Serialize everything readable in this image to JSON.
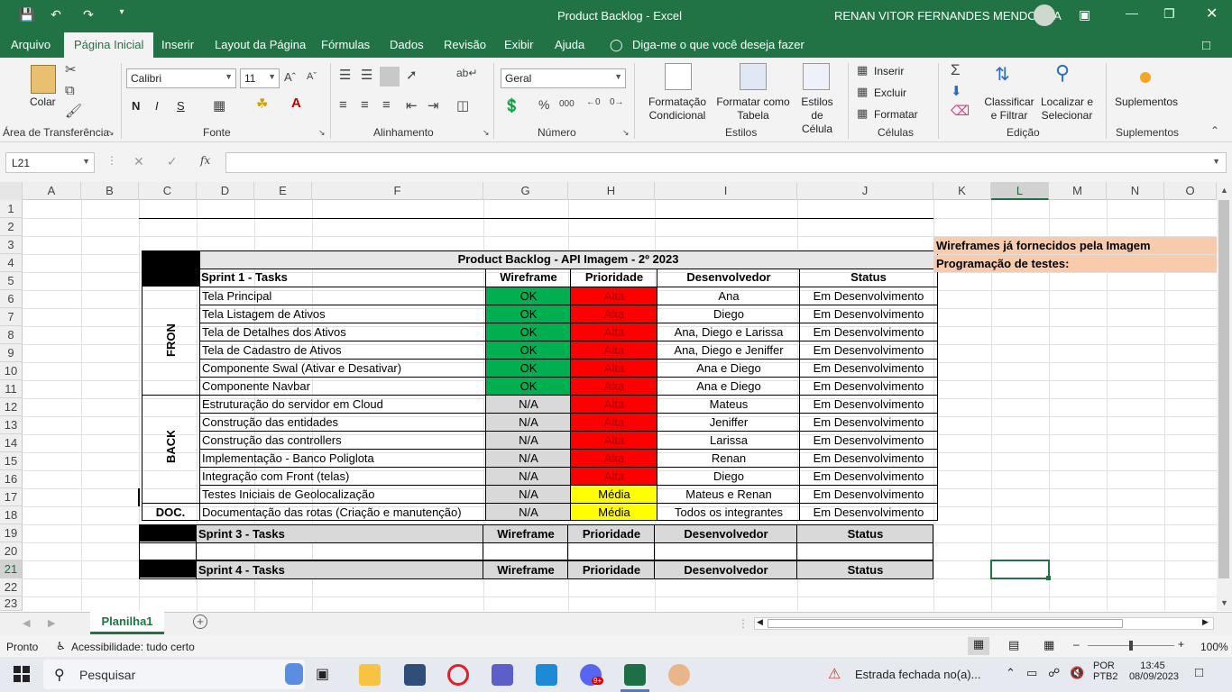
{
  "window": {
    "title": "Product Backlog  -  Excel",
    "user": "RENAN VITOR FERNANDES MENDONCA"
  },
  "tabs": [
    "Arquivo",
    "Página Inicial",
    "Inserir",
    "Layout da Página",
    "Fórmulas",
    "Dados",
    "Revisão",
    "Exibir",
    "Ajuda"
  ],
  "tell_me": "Diga-me o que você deseja fazer",
  "ribbon": {
    "clipboard": {
      "label": "Área de Transferência",
      "paste": "Colar"
    },
    "font": {
      "label": "Fonte",
      "name": "Calibri",
      "size": "11",
      "bold": "N",
      "italic": "I",
      "underline": "S"
    },
    "alignment": {
      "label": "Alinhamento"
    },
    "number": {
      "label": "Número",
      "format": "Geral"
    },
    "styles": {
      "label": "Estilos",
      "cond1": "Formatação",
      "cond2": "Condicional",
      "table1": "Formatar como",
      "table2": "Tabela",
      "cell1": "Estilos de",
      "cell2": "Célula"
    },
    "cells": {
      "label": "Células",
      "insert": "Inserir",
      "delete": "Excluir",
      "format": "Formatar"
    },
    "editing": {
      "label": "Edição",
      "sort1": "Classificar",
      "sort2": "e Filtrar",
      "find1": "Localizar e",
      "find2": "Selecionar"
    },
    "addins": {
      "label": "Suplementos",
      "btn": "Suplementos"
    }
  },
  "formula_bar": {
    "name_box": "L21",
    "fx": "fx",
    "value": ""
  },
  "columns": [
    "A",
    "B",
    "C",
    "D",
    "E",
    "F",
    "G",
    "H",
    "I",
    "J",
    "K",
    "L",
    "M",
    "N",
    "O"
  ],
  "rows": [
    "1",
    "2",
    "3",
    "4",
    "5",
    "6",
    "7",
    "8",
    "9",
    "10",
    "11",
    "12",
    "13",
    "14",
    "15",
    "16",
    "17",
    "18",
    "19",
    "20",
    "21",
    "22",
    "23"
  ],
  "sheet": {
    "title": "Product Backlog - API Imagem - 2º 2023",
    "headers": {
      "tasks": "Sprint 1 - Tasks",
      "wireframe": "Wireframe",
      "priority": "Prioridade",
      "dev": "Desenvolvedor",
      "status": "Status"
    },
    "groups": {
      "front": "FRONT",
      "back": "BACK",
      "doc": "DOC."
    },
    "tasks": [
      {
        "task": "Tela Principal",
        "wireframe": "OK",
        "priority": "Alta",
        "dev": "Ana",
        "status": "Em Desenvolvimento"
      },
      {
        "task": "Tela Listagem de Ativos",
        "wireframe": "OK",
        "priority": "Alta",
        "dev": "Diego",
        "status": "Em Desenvolvimento"
      },
      {
        "task": "Tela de Detalhes dos Ativos",
        "wireframe": "OK",
        "priority": "Alta",
        "dev": "Ana, Diego e Larissa",
        "status": "Em Desenvolvimento"
      },
      {
        "task": "Tela de Cadastro de Ativos",
        "wireframe": "OK",
        "priority": "Alta",
        "dev": "Ana, Diego e Jeniffer",
        "status": "Em Desenvolvimento"
      },
      {
        "task": "Componente Swal (Ativar e Desativar)",
        "wireframe": "OK",
        "priority": "Alta",
        "dev": "Ana e Diego",
        "status": "Em Desenvolvimento"
      },
      {
        "task": "Componente Navbar",
        "wireframe": "OK",
        "priority": "Alta",
        "dev": "Ana e Diego",
        "status": "Em Desenvolvimento"
      },
      {
        "task": "Estruturação do servidor em Cloud",
        "wireframe": "N/A",
        "priority": "Alta",
        "dev": "Mateus",
        "status": "Em Desenvolvimento"
      },
      {
        "task": "Construção das entidades",
        "wireframe": "N/A",
        "priority": "Alta",
        "dev": "Jeniffer",
        "status": "Em Desenvolvimento"
      },
      {
        "task": "Construção das controllers",
        "wireframe": "N/A",
        "priority": "Alta",
        "dev": "Larissa",
        "status": "Em Desenvolvimento"
      },
      {
        "task": "Implementação - Banco Poliglota",
        "wireframe": "N/A",
        "priority": "Alta",
        "dev": "Renan",
        "status": "Em Desenvolvimento"
      },
      {
        "task": "Integração com Front (telas)",
        "wireframe": "N/A",
        "priority": "Alta",
        "dev": "Diego",
        "status": "Em Desenvolvimento"
      },
      {
        "task": "Testes Iniciais de Geolocalização",
        "wireframe": "N/A",
        "priority": "Média",
        "dev": "Mateus e Renan",
        "status": "Em Desenvolvimento"
      },
      {
        "task": "Documentação das rotas (Criação e manutenção)",
        "wireframe": "N/A",
        "priority": "Média",
        "dev": "Todos os integrantes",
        "status": "Em Desenvolvimento"
      }
    ],
    "sprint3": {
      "tasks": "Sprint 3 - Tasks",
      "wireframe": "Wireframe",
      "priority": "Prioridade",
      "dev": "Desenvolvedor",
      "status": "Status"
    },
    "sprint4": {
      "tasks": "Sprint 4 - Tasks",
      "wireframe": "Wireframe",
      "priority": "Prioridade",
      "dev": "Desenvolvedor",
      "status": "Status"
    },
    "legend": [
      "Wireframes já fornecidos pela Imagem",
      "Programação de testes:"
    ],
    "colors": {
      "ok": "#00b050",
      "alta": "#ff0000",
      "media": "#ffff00",
      "na": "#d9d9d9",
      "legend": "#f8cbad"
    }
  },
  "sheet_tab": "Planilha1",
  "status": {
    "ready": "Pronto",
    "accessibility": "Acessibilidade: tudo certo",
    "zoom": "100%"
  },
  "taskbar": {
    "search": "Pesquisar",
    "weather": "Estrada fechada no(a)...",
    "lang1": "POR",
    "lang2": "PTB2",
    "time": "13:45",
    "date": "08/09/2023",
    "notif": "9+"
  }
}
